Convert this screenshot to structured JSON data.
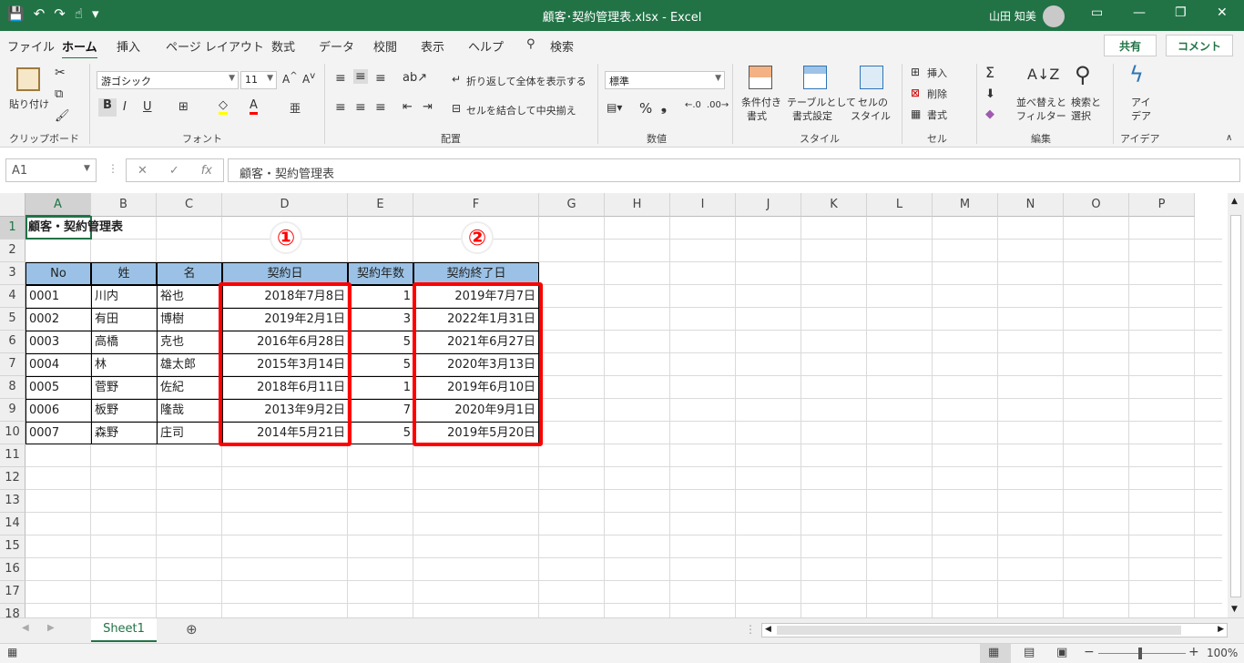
{
  "window": {
    "title": "顧客･契約管理表.xlsx  -  Excel",
    "user": "山田 知美"
  },
  "menu": {
    "tabs": [
      "ファイル",
      "ホーム",
      "挿入",
      "ページ レイアウト",
      "数式",
      "データ",
      "校閲",
      "表示",
      "ヘルプ",
      "検索"
    ],
    "share": "共有",
    "comment": "コメント"
  },
  "ribbon": {
    "clipboard": {
      "paste": "貼り付け",
      "label": "クリップボード"
    },
    "font": {
      "name": "游ゴシック",
      "size": "11",
      "label": "フォント"
    },
    "alignment": {
      "wrap": "折り返して全体を表示する",
      "merge": "セルを結合して中央揃え",
      "label": "配置"
    },
    "number": {
      "format": "標準",
      "label": "数値"
    },
    "styles": {
      "cond1": "条件付き",
      "cond2": "書式",
      "table1": "テーブルとして",
      "table2": "書式設定",
      "cell1": "セルの",
      "cell2": "スタイル",
      "label": "スタイル"
    },
    "cells": {
      "insert": "挿入",
      "delete": "削除",
      "format": "書式",
      "label": "セル"
    },
    "editing": {
      "sort1": "並べ替えと",
      "sort2": "フィルター",
      "find1": "検索と",
      "find2": "選択",
      "label": "編集"
    },
    "ideas": {
      "l1": "アイ",
      "l2": "デア",
      "label": "アイデア"
    }
  },
  "formula_bar": {
    "name_box": "A1",
    "content": "顧客・契約管理表"
  },
  "columns": [
    "A",
    "B",
    "C",
    "D",
    "E",
    "F",
    "G",
    "H",
    "I",
    "J",
    "K",
    "L",
    "M",
    "N",
    "O",
    "P"
  ],
  "rows": [
    "1",
    "2",
    "3",
    "4",
    "5",
    "6",
    "7",
    "8",
    "9",
    "10",
    "11",
    "12",
    "13",
    "14",
    "15",
    "16",
    "17",
    "18"
  ],
  "sheet": {
    "title": "顧客・契約管理表",
    "headers": [
      "No",
      "姓",
      "名",
      "契約日",
      "契約年数",
      "契約終了日"
    ],
    "data": [
      [
        "0001",
        "川内",
        "裕也",
        "2018年7月8日",
        "1",
        "2019年7月7日"
      ],
      [
        "0002",
        "有田",
        "博樹",
        "2019年2月1日",
        "3",
        "2022年1月31日"
      ],
      [
        "0003",
        "高橋",
        "克也",
        "2016年6月28日",
        "5",
        "2021年6月27日"
      ],
      [
        "0004",
        "林",
        "雄太郎",
        "2015年3月14日",
        "5",
        "2020年3月13日"
      ],
      [
        "0005",
        "菅野",
        "佐紀",
        "2018年6月11日",
        "1",
        "2019年6月10日"
      ],
      [
        "0006",
        "板野",
        "隆哉",
        "2013年9月2日",
        "7",
        "2020年9月1日"
      ],
      [
        "0007",
        "森野",
        "庄司",
        "2014年5月21日",
        "5",
        "2019年5月20日"
      ]
    ]
  },
  "annotations": {
    "one": "①",
    "two": "②",
    "color": "#ff0000"
  },
  "sheet_tabs": {
    "active": "Sheet1"
  },
  "status": {
    "zoom": "100%"
  },
  "colors": {
    "accent": "#217346",
    "header_fill": "#9bc2e6"
  }
}
